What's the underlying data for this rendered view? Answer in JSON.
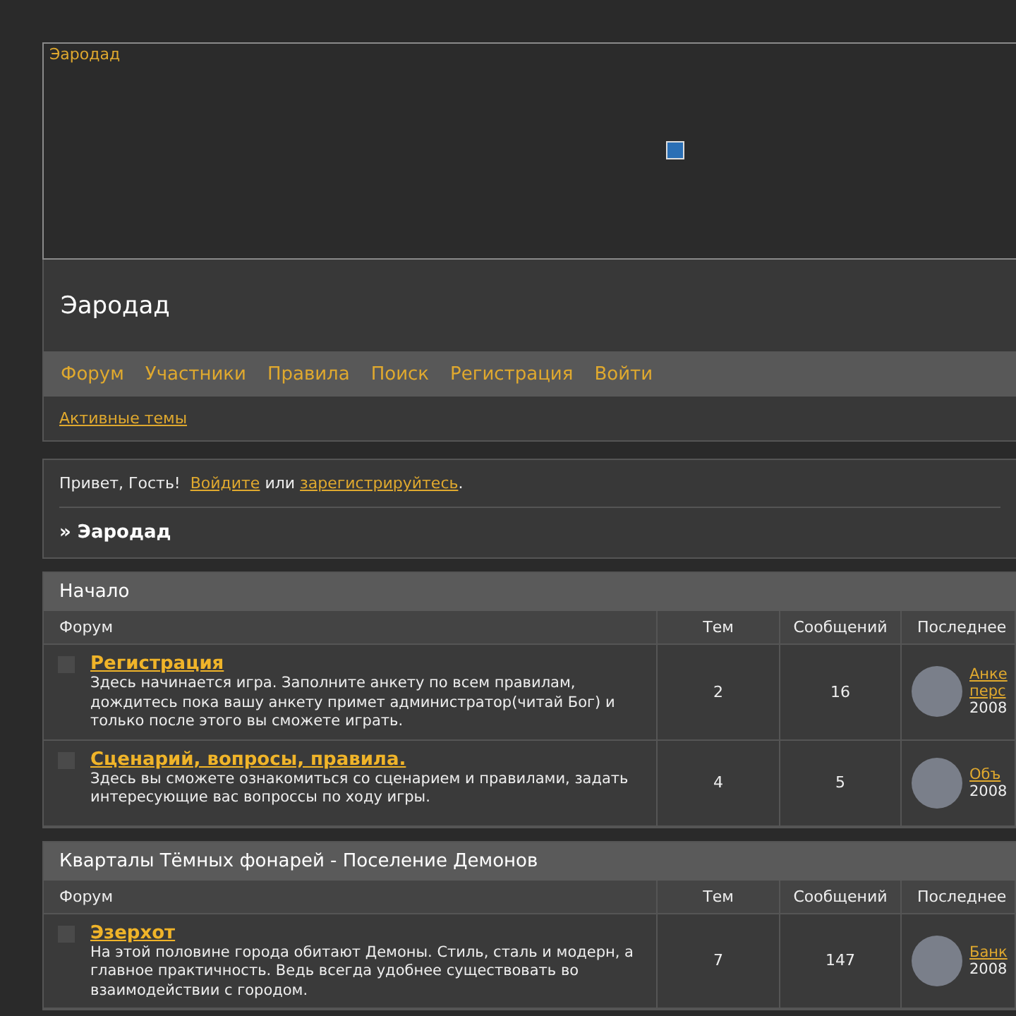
{
  "banner": {
    "label": "Эародад"
  },
  "header": {
    "title": "Эародад"
  },
  "nav": [
    {
      "label": "Форум"
    },
    {
      "label": "Участники"
    },
    {
      "label": "Правила"
    },
    {
      "label": "Поиск"
    },
    {
      "label": "Регистрация"
    },
    {
      "label": "Войти"
    }
  ],
  "subnav": [
    {
      "label": "Активные темы"
    }
  ],
  "welcome": {
    "greeting": "Привет, Гость!",
    "login_link": "Войдите",
    "or": "или",
    "register_link": "зарегистрируйтесь",
    "end": "."
  },
  "breadcrumb": "» Эародад",
  "categories": [
    {
      "title": "Начало",
      "columns": [
        "Форум",
        "Тем",
        "Сообщений",
        "Последнее"
      ],
      "forums": [
        {
          "name": "Регистрация",
          "description": "Здесь начинается игра. Заполните анкету по всем правилам, дождитесь пока вашу анкету примет администратор(читай Бог) и только после этого вы сможете играть.",
          "topics": "2",
          "posts": "16",
          "last_links": [
            "Анке",
            "перс"
          ],
          "last_date": "2008"
        },
        {
          "name": "Сценарий, вопросы, правила.",
          "description": "Здесь вы сможете ознакомиться со сценарием и правилами, задать интересующие вас вопроссы по ходу игры.",
          "topics": "4",
          "posts": "5",
          "last_links": [
            "Объ"
          ],
          "last_date": "2008"
        }
      ]
    },
    {
      "title": "Кварталы Тёмных фонарей - Поселение Демонов",
      "columns": [
        "Форум",
        "Тем",
        "Сообщений",
        "Последнее"
      ],
      "forums": [
        {
          "name": "Эзерхот",
          "description": "На этой половине города обитают Демоны. Стиль, сталь и модерн, а главное практичность. Ведь всегда удобнее существовать во взаимодействии с городом.",
          "topics": "7",
          "posts": "147",
          "last_links": [
            "Банк"
          ],
          "last_date": "2008"
        }
      ]
    }
  ]
}
